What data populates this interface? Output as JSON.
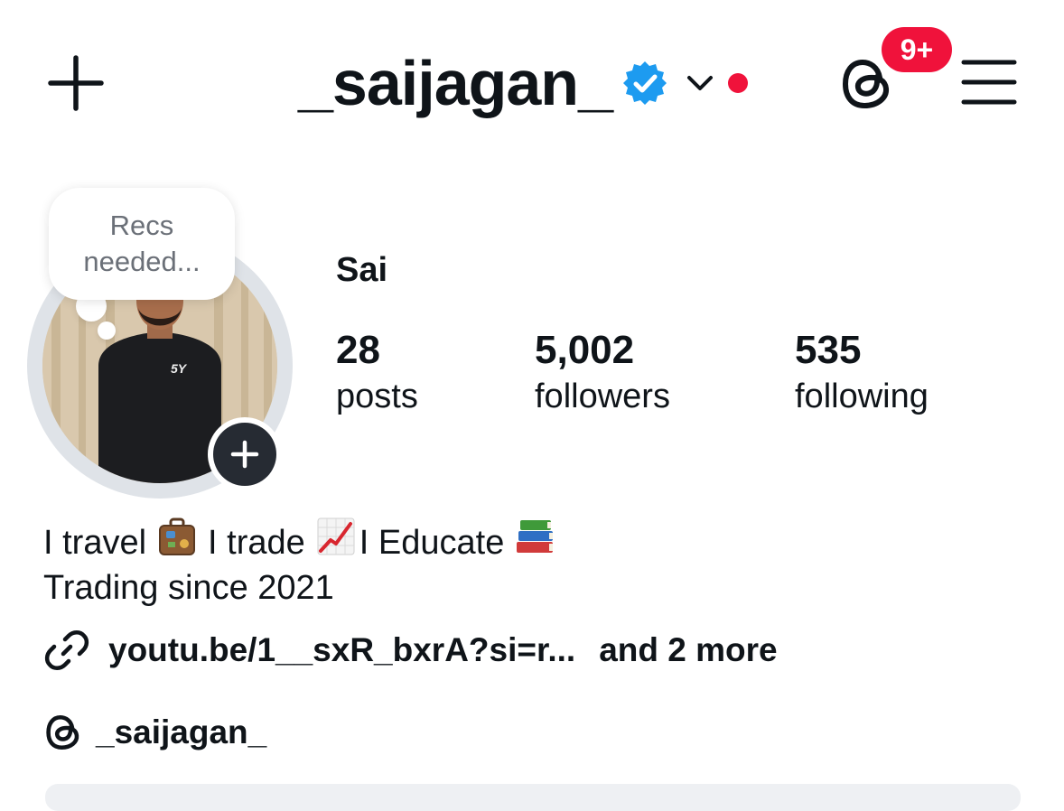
{
  "header": {
    "username": "_saijagan_",
    "notification_count": "9+",
    "colors": {
      "accent_red": "#f0123b",
      "verified_blue": "#1d9bf0"
    },
    "icons": [
      "plus-icon",
      "verified-badge-icon",
      "chevron-down-icon",
      "threads-icon",
      "menu-icon"
    ]
  },
  "profile": {
    "note": "Recs needed...",
    "display_name": "Sai",
    "stats": [
      {
        "value": "28",
        "label": "posts"
      },
      {
        "value": "5,002",
        "label": "followers"
      },
      {
        "value": "535",
        "label": "following"
      }
    ]
  },
  "bio": {
    "line1": {
      "a": "I travel",
      "b": "I trade",
      "c": "I Educate"
    },
    "emojis": {
      "travel": "suitcase-emoji",
      "trade": "chart-increasing-emoji",
      "educate": "books-emoji"
    },
    "line2": "Trading since 2021"
  },
  "links": {
    "primary": "youtu.be/1__sxR_bxrA?si=r...",
    "more": "and 2 more"
  },
  "threads": {
    "handle": "_saijagan_"
  }
}
